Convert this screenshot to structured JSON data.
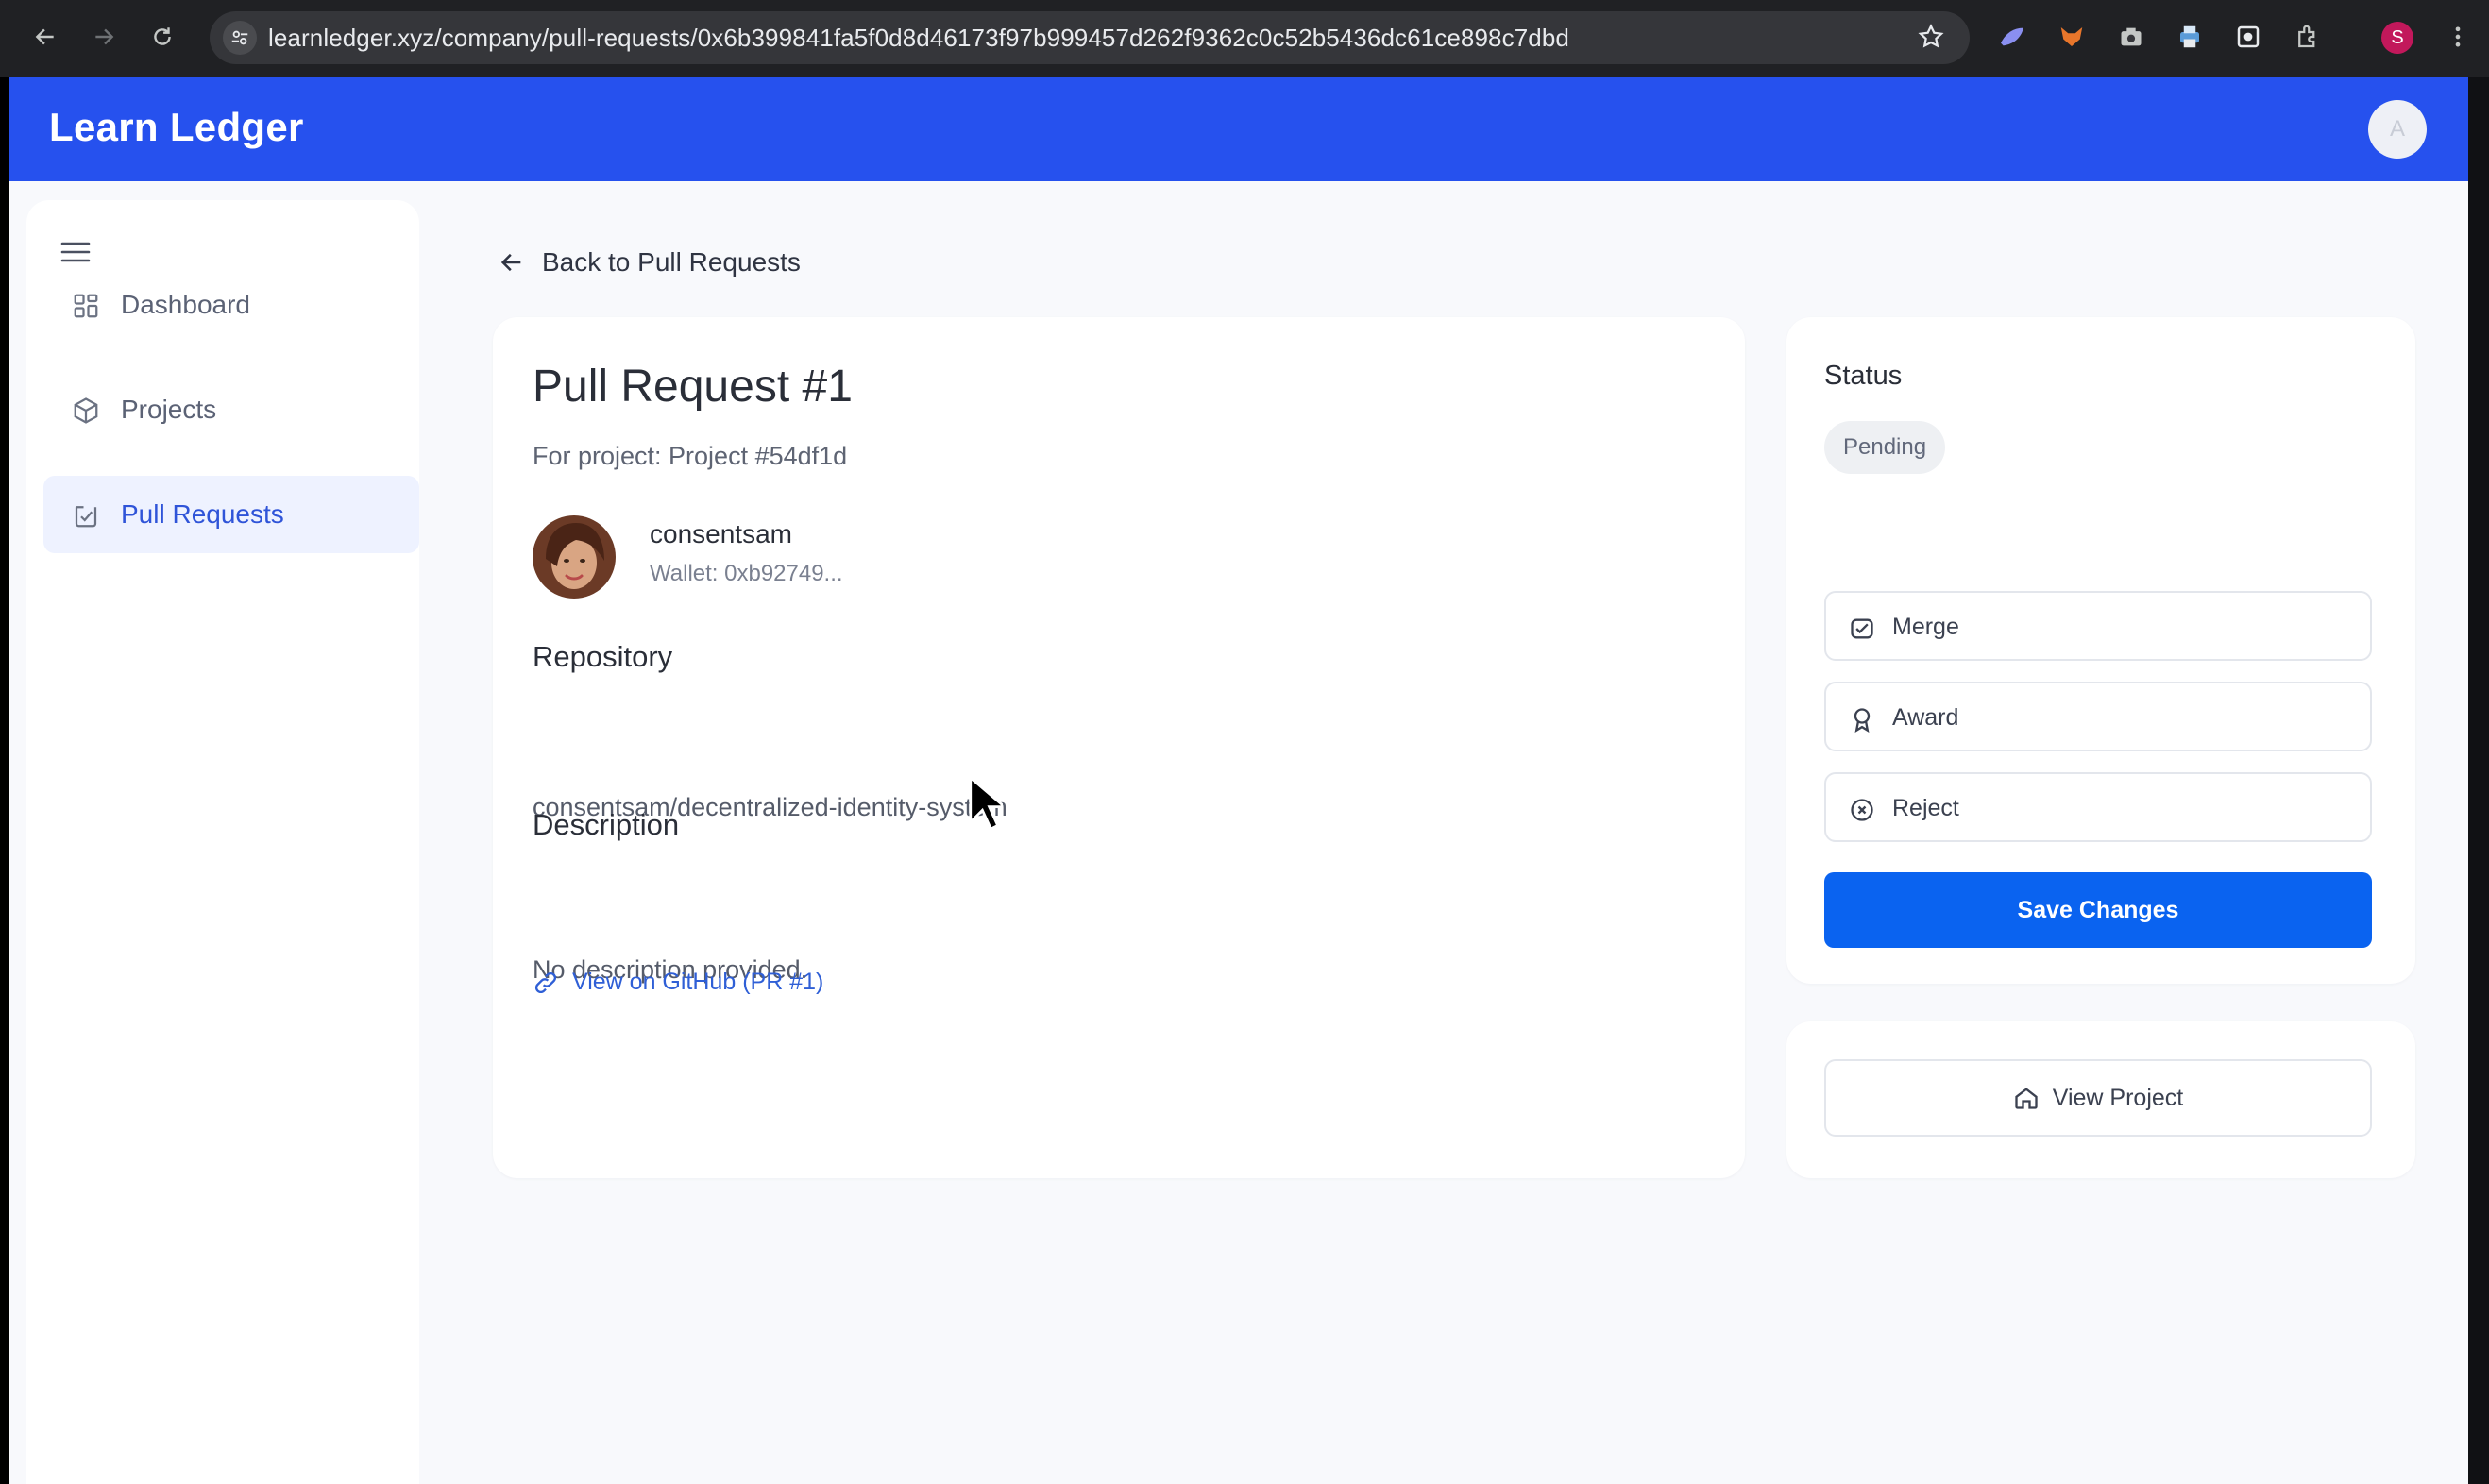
{
  "browser": {
    "url": "learnledger.xyz/company/pull-requests/0x6b399841fa5f0d8d46173f97b999457d262f9362c0c52b5436dc61ce898c7dbd",
    "profile_initial": "S"
  },
  "app": {
    "brand": "Learn Ledger",
    "user_initial": "A"
  },
  "sidebar": {
    "items": [
      {
        "label": "Dashboard",
        "icon": "grid-icon"
      },
      {
        "label": "Projects",
        "icon": "box-icon"
      },
      {
        "label": "Pull Requests",
        "icon": "pull-request-icon",
        "active": true
      }
    ]
  },
  "back_link": "Back to Pull Requests",
  "pr": {
    "title": "Pull Request #1",
    "project_line": "For project: Project #54df1d",
    "author": "consentsam",
    "wallet": "Wallet: 0xb92749...",
    "repository_heading": "Repository",
    "repository": "consentsam/decentralized-identity-system",
    "description_heading": "Description",
    "description": "No description provided.",
    "github_link": "View on GitHub (PR #1)"
  },
  "status_panel": {
    "heading": "Status",
    "current": "Pending",
    "options": [
      {
        "label": "Merge",
        "icon": "merge-icon"
      },
      {
        "label": "Award",
        "icon": "award-icon"
      },
      {
        "label": "Reject",
        "icon": "reject-icon"
      }
    ],
    "save_label": "Save Changes"
  },
  "project_panel": {
    "view_label": "View Project"
  },
  "colors": {
    "brand_bar": "#2651ee",
    "primary_button": "#0a63f0",
    "active_nav_bg": "#eef2ff"
  }
}
